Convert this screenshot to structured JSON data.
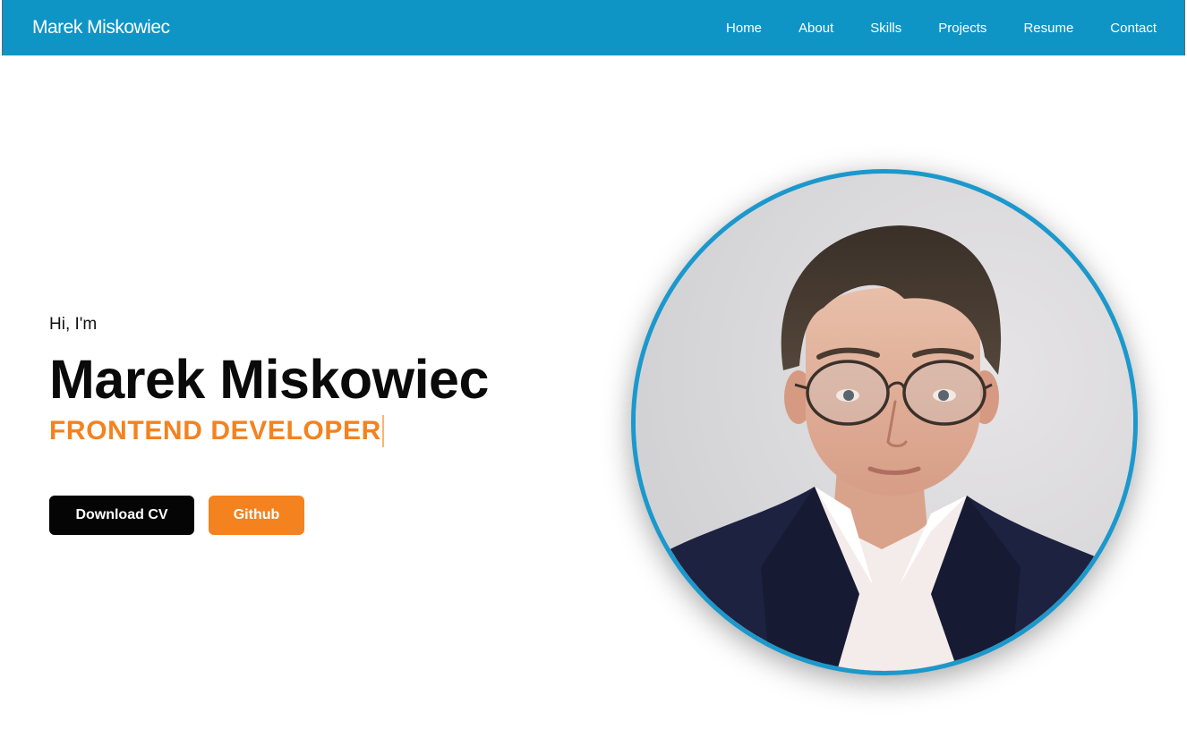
{
  "navbar": {
    "brand": "Marek Miskowiec",
    "links": [
      "Home",
      "About",
      "Skills",
      "Projects",
      "Resume",
      "Contact"
    ],
    "background_color": "#0e95c6"
  },
  "hero": {
    "greeting": "Hi, I'm",
    "name": "Marek Miskowiec",
    "role": "FRONTEND DEVELOPER",
    "role_color": "#f4821f",
    "buttons": {
      "download_cv": "Download CV",
      "github": "Github"
    },
    "photo": {
      "description_icon": "profile-photo",
      "border_color": "#1b98cc"
    }
  }
}
